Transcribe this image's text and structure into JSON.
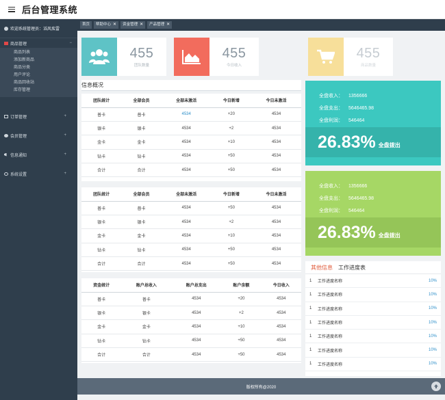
{
  "app": {
    "title": "后台管理系统"
  },
  "sidebar": {
    "welcome": "欢迎系统管理员：滔风疾雷",
    "groups": [
      {
        "label": "商品管理",
        "expanded_caret": "−",
        "items": [
          "商品列表",
          "添加新商品",
          "商品分类",
          "用户评论",
          "商品回收站",
          "库存管理"
        ]
      }
    ],
    "items": [
      {
        "label": "订单管理",
        "caret": "+"
      },
      {
        "label": "会员管理",
        "caret": "+"
      },
      {
        "label": "信息通知",
        "caret": "+"
      },
      {
        "label": "系统设置",
        "caret": "+"
      }
    ]
  },
  "tabs": [
    {
      "label": "首页",
      "closable": false
    },
    {
      "label": "帮助中心",
      "closable": true
    },
    {
      "label": "资金管理",
      "closable": true
    },
    {
      "label": "产品管理",
      "closable": true
    }
  ],
  "tab_close_glyph": "✕",
  "stats": [
    {
      "value": "455",
      "label": "团队数量",
      "color": "#5ec3c6",
      "icon": "users-icon"
    },
    {
      "value": "455",
      "label": "今日收入",
      "color": "#f26c5d",
      "icon": "area-chart-icon"
    },
    {
      "value": "455",
      "label": "商品数量",
      "color": "#f7df9a",
      "icon": "cart-icon"
    }
  ],
  "overview": {
    "title": "信息概况"
  },
  "table1": {
    "headers": [
      "团队统计",
      "全部会员",
      "全部未激活",
      "今日新增",
      "今日未激活"
    ],
    "rows": [
      [
        "普卡",
        "普卡",
        "4534",
        "+20",
        "4534"
      ],
      [
        "银卡",
        "银卡",
        "4534",
        "+2",
        "4534"
      ],
      [
        "金卡",
        "金卡",
        "4534",
        "+10",
        "4534"
      ],
      [
        "钻卡",
        "钻卡",
        "4534",
        "+50",
        "4534"
      ],
      [
        "合计",
        "合计",
        "4534",
        "+50",
        "4534"
      ]
    ]
  },
  "table2": {
    "headers": [
      "团队统计",
      "全部会员",
      "全部未激活",
      "今日新增",
      "今日未激活"
    ],
    "rows": [
      [
        "普卡",
        "普卡",
        "4534",
        "+50",
        "4534"
      ],
      [
        "银卡",
        "银卡",
        "4534",
        "+2",
        "4534"
      ],
      [
        "金卡",
        "金卡",
        "4534",
        "+10",
        "4534"
      ],
      [
        "钻卡",
        "钻卡",
        "4534",
        "+50",
        "4534"
      ],
      [
        "合计",
        "合计",
        "4534",
        "+50",
        "4534"
      ]
    ]
  },
  "table3": {
    "headers": [
      "资金统计",
      "账户总收入",
      "账户总支出",
      "账户余额",
      "今日收入"
    ],
    "rows": [
      [
        "普卡",
        "普卡",
        "4534",
        "+20",
        "4534"
      ],
      [
        "银卡",
        "银卡",
        "4534",
        "+2",
        "4534"
      ],
      [
        "金卡",
        "金卡",
        "4534",
        "+10",
        "4534"
      ],
      [
        "钻卡",
        "钻卡",
        "4534",
        "+50",
        "4534"
      ],
      [
        "合计",
        "合计",
        "4534",
        "+50",
        "4534"
      ]
    ]
  },
  "summary": [
    {
      "color_top": "#3cc8c0",
      "color_bottom": "#35b3ab",
      "income_label": "全盘收入：",
      "income": "1356666",
      "expense_label": "全盘支出：",
      "expense": "5646465.98",
      "profit_label": "全盘利润：",
      "profit": "546464",
      "percent": "26.83%",
      "percent_label": "全盘拨出"
    },
    {
      "color_top": "#a6d765",
      "color_bottom": "#95c558",
      "income_label": "全盘收入：",
      "income": "1356666",
      "expense_label": "全盘支出：",
      "expense": "5646465.98",
      "profit_label": "全盘利润：",
      "profit": "546464",
      "percent": "26.83%",
      "percent_label": "全盘拨出"
    }
  ],
  "info": {
    "tabs": [
      "其他信息",
      "工作进度表"
    ],
    "rows": [
      {
        "idx": "1",
        "name": "工作进度名称",
        "pct": "10%"
      },
      {
        "idx": "1",
        "name": "工作进度名称",
        "pct": "10%"
      },
      {
        "idx": "1",
        "name": "工作进度名称",
        "pct": "10%"
      },
      {
        "idx": "1",
        "name": "工作进度名称",
        "pct": "10%"
      },
      {
        "idx": "1",
        "name": "工作进度名称",
        "pct": "10%"
      },
      {
        "idx": "1",
        "name": "工作进度名称",
        "pct": "10%"
      },
      {
        "idx": "1",
        "name": "工作进度名称",
        "pct": "10%"
      }
    ]
  },
  "footer": {
    "copyright": "版权所有@2020"
  }
}
